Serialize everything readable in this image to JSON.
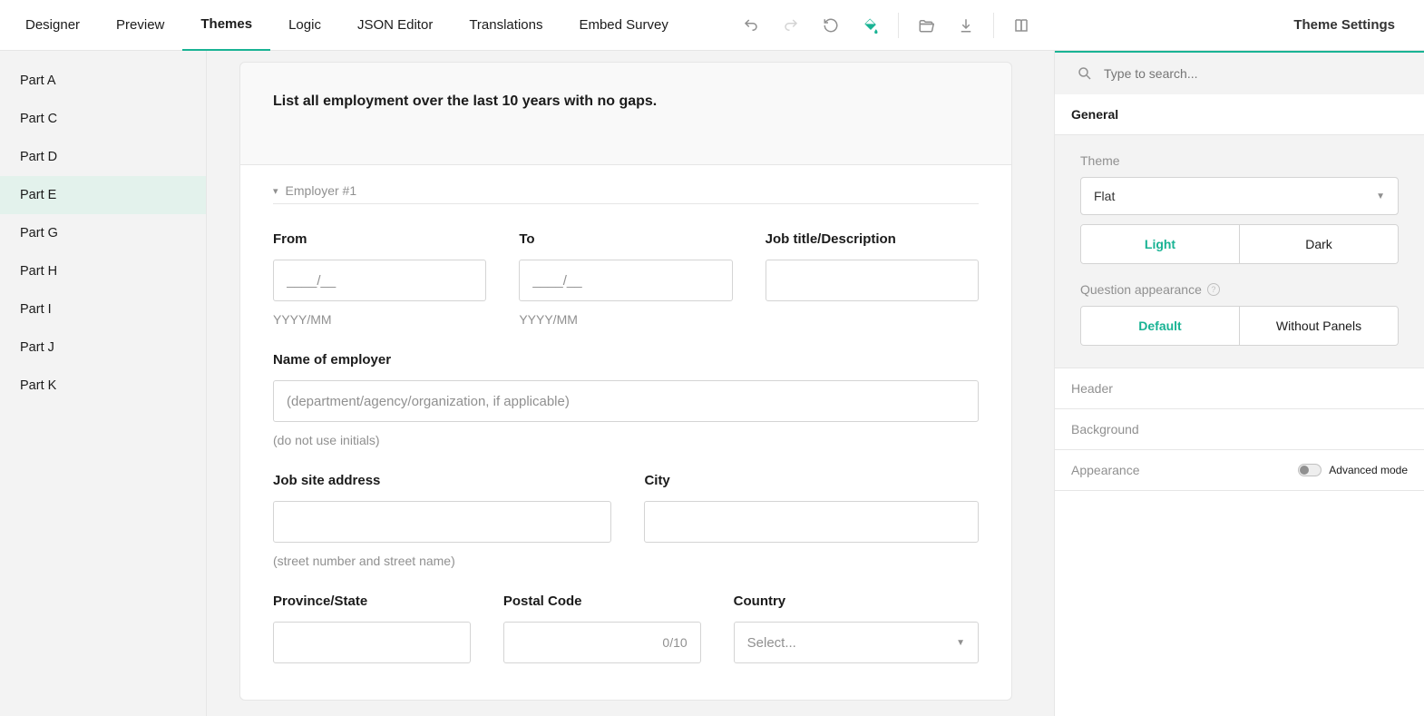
{
  "topTabs": {
    "designer": "Designer",
    "preview": "Preview",
    "themes": "Themes",
    "logic": "Logic",
    "json": "JSON Editor",
    "translations": "Translations",
    "embed": "Embed Survey"
  },
  "propsHeader": "Theme Settings",
  "search": {
    "placeholder": "Type to search..."
  },
  "sidebar": {
    "items": [
      "Part A",
      "Part C",
      "Part D",
      "Part E",
      "Part G",
      "Part H",
      "Part I",
      "Part J",
      "Part K"
    ],
    "activeIndex": 3
  },
  "card": {
    "title": "List all employment over the last 10 years with no gaps.",
    "panelTitle": "Employer #1",
    "fields": {
      "from": {
        "label": "From",
        "placeholder": "____/__",
        "hint": "YYYY/MM"
      },
      "to": {
        "label": "To",
        "placeholder": "____/__",
        "hint": "YYYY/MM"
      },
      "jobtitle": {
        "label": "Job title/Description"
      },
      "employer": {
        "label": "Name of employer",
        "placeholder": "(department/agency/organization, if applicable)",
        "hint": "(do not use initials)"
      },
      "address": {
        "label": "Job site address",
        "hint": "(street number and street name)"
      },
      "city": {
        "label": "City"
      },
      "province": {
        "label": "Province/State"
      },
      "postal": {
        "label": "Postal Code",
        "counter": "0/10"
      },
      "country": {
        "label": "Country",
        "placeholder": "Select..."
      }
    }
  },
  "props": {
    "general": "General",
    "themeLabel": "Theme",
    "themeValue": "Flat",
    "modeLight": "Light",
    "modeDark": "Dark",
    "qaLabel": "Question appearance",
    "qaDefault": "Default",
    "qaWithout": "Without Panels",
    "header": "Header",
    "background": "Background",
    "appearance": "Appearance",
    "advanced": "Advanced mode"
  }
}
